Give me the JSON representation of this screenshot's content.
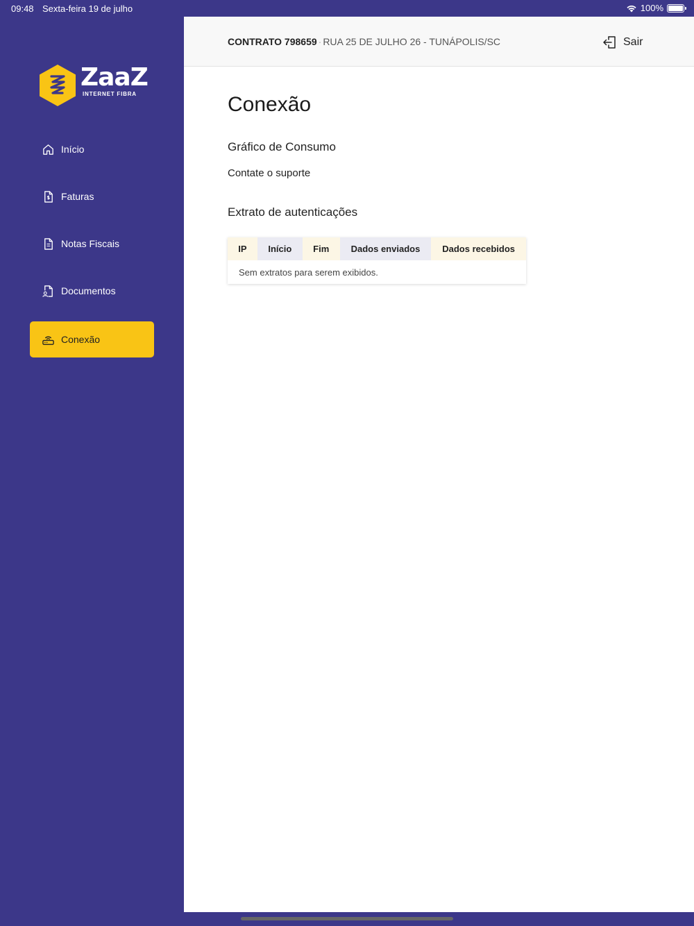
{
  "status_bar": {
    "time": "09:48",
    "date": "Sexta-feira 19 de julho",
    "battery": "100%"
  },
  "brand": {
    "name": "ZaaZ",
    "tagline": "INTERNET FIBRA",
    "primary_color": "#3c3789",
    "accent_color": "#f9c415"
  },
  "sidebar": {
    "items": [
      {
        "label": "Início",
        "icon": "home-icon",
        "active": false
      },
      {
        "label": "Faturas",
        "icon": "invoice-icon",
        "active": false
      },
      {
        "label": "Notas Fiscais",
        "icon": "document-icon",
        "active": false
      },
      {
        "label": "Documentos",
        "icon": "document-user-icon",
        "active": false
      },
      {
        "label": "Conexão",
        "icon": "router-icon",
        "active": true
      }
    ]
  },
  "header": {
    "contract_label": "CONTRATO 798659",
    "address": "RUA 25 DE JULHO 26 - TUNÁPOLIS/SC",
    "logout_label": "Sair",
    "logout_icon": "logout-icon"
  },
  "main": {
    "title": "Conexão",
    "consumption_section": "Gráfico de Consumo",
    "support_text": "Contate o suporte",
    "extract_section": "Extrato de autenticações",
    "table": {
      "columns": [
        "IP",
        "Início",
        "Fim",
        "Dados enviados",
        "Dados recebidos"
      ],
      "empty_message": "Sem extratos para serem exibidos."
    }
  }
}
